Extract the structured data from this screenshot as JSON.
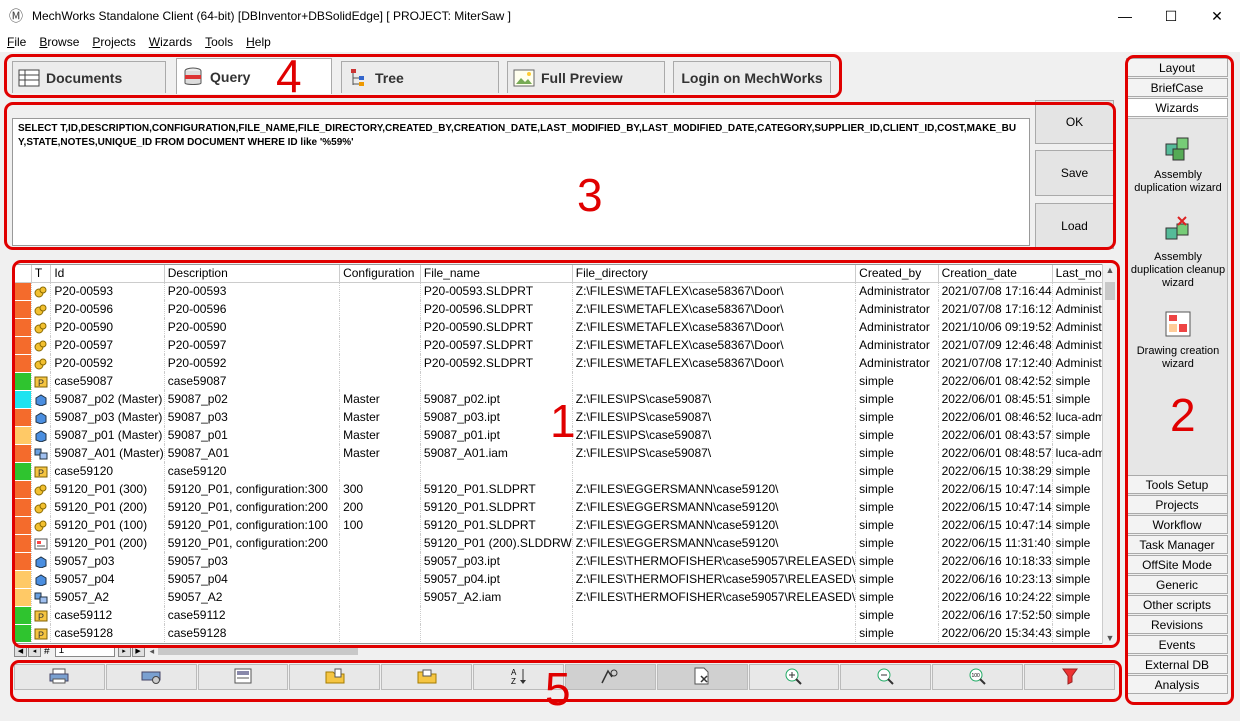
{
  "window": {
    "title": "MechWorks Standalone Client (64-bit) [DBInventor+DBSolidEdge] [ PROJECT: MiterSaw ]",
    "minimize": "—",
    "maximize": "☐",
    "close": "✕"
  },
  "menu": [
    {
      "first": "F",
      "rest": "ile"
    },
    {
      "first": "B",
      "rest": "rowse"
    },
    {
      "first": "P",
      "rest": "rojects"
    },
    {
      "first": "W",
      "rest": "izards"
    },
    {
      "first": "T",
      "rest": "ools"
    },
    {
      "first": "H",
      "rest": "elp"
    }
  ],
  "tabs": [
    {
      "label": "Documents",
      "icon": "table-icon"
    },
    {
      "label": "Query",
      "icon": "database-icon"
    },
    {
      "label": "Tree",
      "icon": "tree-icon"
    },
    {
      "label": "Full Preview",
      "icon": "image-icon"
    },
    {
      "label": "Login on MechWorks",
      "icon": ""
    }
  ],
  "query": {
    "text": "SELECT T,ID,DESCRIPTION,CONFIGURATION,FILE_NAME,FILE_DIRECTORY,CREATED_BY,CREATION_DATE,LAST_MODIFIED_BY,LAST_MODIFIED_DATE,CATEGORY,SUPPLIER_ID,CLIENT_ID,COST,MAKE_BUY,STATE,NOTES,UNIQUE_ID FROM DOCUMENT WHERE ID like '%59%'",
    "ok": "OK",
    "save": "Save",
    "load": "Load"
  },
  "grid": {
    "columns": [
      "T",
      "Id",
      "Description",
      "Configuration",
      "File_name",
      "File_directory",
      "Created_by",
      "Creation_date",
      "Last_moc"
    ],
    "rows": [
      {
        "color": "#f46b2c",
        "type": "asm",
        "id": "P20-00593",
        "desc": "P20-00593",
        "conf": "",
        "file": "P20-00593.SLDPRT",
        "dir": "Z:\\FILES\\METAFLEX\\case58367\\Door\\",
        "by": "Administrator",
        "date": "2021/07/08 17:16:44",
        "mod": "Administ"
      },
      {
        "color": "#f46b2c",
        "type": "asm",
        "id": "P20-00596",
        "desc": "P20-00596",
        "conf": "",
        "file": "P20-00596.SLDPRT",
        "dir": "Z:\\FILES\\METAFLEX\\case58367\\Door\\",
        "by": "Administrator",
        "date": "2021/07/08 17:16:12",
        "mod": "Administ"
      },
      {
        "color": "#f46b2c",
        "type": "asm",
        "id": "P20-00590",
        "desc": "P20-00590",
        "conf": "",
        "file": "P20-00590.SLDPRT",
        "dir": "Z:\\FILES\\METAFLEX\\case58367\\Door\\",
        "by": "Administrator",
        "date": "2021/10/06 09:19:52",
        "mod": "Administ"
      },
      {
        "color": "#f46b2c",
        "type": "asm",
        "id": "P20-00597",
        "desc": "P20-00597",
        "conf": "",
        "file": "P20-00597.SLDPRT",
        "dir": "Z:\\FILES\\METAFLEX\\case58367\\Door\\",
        "by": "Administrator",
        "date": "2021/07/09 12:46:48",
        "mod": "Administ"
      },
      {
        "color": "#f46b2c",
        "type": "asm",
        "id": "P20-00592",
        "desc": "P20-00592",
        "conf": "",
        "file": "P20-00592.SLDPRT",
        "dir": "Z:\\FILES\\METAFLEX\\case58367\\Door\\",
        "by": "Administrator",
        "date": "2021/07/08 17:12:40",
        "mod": "Administ"
      },
      {
        "color": "#2fc42f",
        "type": "proj",
        "id": "case59087",
        "desc": "case59087",
        "conf": "",
        "file": "",
        "dir": "",
        "by": "simple",
        "date": "2022/06/01 08:42:52",
        "mod": "simple"
      },
      {
        "color": "#1ee3f0",
        "type": "part",
        "id": "59087_p02 (Master)",
        "desc": "59087_p02",
        "conf": "Master",
        "file": "59087_p02.ipt",
        "dir": "Z:\\FILES\\IPS\\case59087\\",
        "by": "simple",
        "date": "2022/06/01 08:45:51",
        "mod": "simple"
      },
      {
        "color": "#f46b2c",
        "type": "part",
        "id": "59087_p03 (Master)",
        "desc": "59087_p03",
        "conf": "Master",
        "file": "59087_p03.ipt",
        "dir": "Z:\\FILES\\IPS\\case59087\\",
        "by": "simple",
        "date": "2022/06/01 08:46:52",
        "mod": "luca-adm"
      },
      {
        "color": "#ffc966",
        "type": "part",
        "id": "59087_p01 (Master)",
        "desc": "59087_p01",
        "conf": "Master",
        "file": "59087_p01.ipt",
        "dir": "Z:\\FILES\\IPS\\case59087\\",
        "by": "simple",
        "date": "2022/06/01 08:43:57",
        "mod": "simple"
      },
      {
        "color": "#f46b2c",
        "type": "iam",
        "id": "59087_A01 (Master)",
        "desc": "59087_A01",
        "conf": "Master",
        "file": "59087_A01.iam",
        "dir": "Z:\\FILES\\IPS\\case59087\\",
        "by": "simple",
        "date": "2022/06/01 08:48:57",
        "mod": "luca-adm"
      },
      {
        "color": "#2fc42f",
        "type": "proj",
        "id": "case59120",
        "desc": "case59120",
        "conf": "",
        "file": "",
        "dir": "",
        "by": "simple",
        "date": "2022/06/15 10:38:29",
        "mod": "simple"
      },
      {
        "color": "#f46b2c",
        "type": "asm",
        "id": "59120_P01 (300)",
        "desc": "59120_P01, configuration:300",
        "conf": "300",
        "file": "59120_P01.SLDPRT",
        "dir": "Z:\\FILES\\EGGERSMANN\\case59120\\",
        "by": "simple",
        "date": "2022/06/15 10:47:14",
        "mod": "simple"
      },
      {
        "color": "#f46b2c",
        "type": "asm",
        "id": "59120_P01 (200)",
        "desc": "59120_P01, configuration:200",
        "conf": "200",
        "file": "59120_P01.SLDPRT",
        "dir": "Z:\\FILES\\EGGERSMANN\\case59120\\",
        "by": "simple",
        "date": "2022/06/15 10:47:14",
        "mod": "simple"
      },
      {
        "color": "#f46b2c",
        "type": "asm",
        "id": "59120_P01 (100)",
        "desc": "59120_P01, configuration:100",
        "conf": "100",
        "file": "59120_P01.SLDPRT",
        "dir": "Z:\\FILES\\EGGERSMANN\\case59120\\",
        "by": "simple",
        "date": "2022/06/15 10:47:14",
        "mod": "simple"
      },
      {
        "color": "#f46b2c",
        "type": "drw",
        "id": "59120_P01 (200)",
        "desc": "59120_P01, configuration:200",
        "conf": "",
        "file": "59120_P01 (200).SLDDRW",
        "dir": "Z:\\FILES\\EGGERSMANN\\case59120\\",
        "by": "simple",
        "date": "2022/06/15 11:31:40",
        "mod": "simple"
      },
      {
        "color": "#f46b2c",
        "type": "part",
        "id": "59057_p03",
        "desc": "59057_p03",
        "conf": "",
        "file": "59057_p03.ipt",
        "dir": "Z:\\FILES\\THERMOFISHER\\case59057\\RELEASED\\",
        "by": "simple",
        "date": "2022/06/16 10:18:33",
        "mod": "simple"
      },
      {
        "color": "#ffc966",
        "type": "part",
        "id": "59057_p04",
        "desc": "59057_p04",
        "conf": "",
        "file": "59057_p04.ipt",
        "dir": "Z:\\FILES\\THERMOFISHER\\case59057\\RELEASED\\",
        "by": "simple",
        "date": "2022/06/16 10:23:13",
        "mod": "simple"
      },
      {
        "color": "#ffc966",
        "type": "iam",
        "id": "59057_A2",
        "desc": "59057_A2",
        "conf": "",
        "file": "59057_A2.iam",
        "dir": "Z:\\FILES\\THERMOFISHER\\case59057\\RELEASED\\",
        "by": "simple",
        "date": "2022/06/16 10:24:22",
        "mod": "simple"
      },
      {
        "color": "#2fc42f",
        "type": "proj",
        "id": "case59112",
        "desc": "case59112",
        "conf": "",
        "file": "",
        "dir": "",
        "by": "simple",
        "date": "2022/06/16 17:52:50",
        "mod": "simple"
      },
      {
        "color": "#2fc42f",
        "type": "proj",
        "id": "case59128",
        "desc": "case59128",
        "conf": "",
        "file": "",
        "dir": "",
        "by": "simple",
        "date": "2022/06/20 15:34:43",
        "mod": "simple"
      }
    ]
  },
  "pager": {
    "hash": "#",
    "page": "1"
  },
  "toolbar": [
    "print-icon",
    "print-setup-icon",
    "print-preview-icon",
    "new-folder-icon",
    "open-folder-icon",
    "sort-az-icon",
    "find-icon",
    "delete-doc-icon",
    "zoom-in-icon",
    "zoom-out-icon",
    "zoom-100-icon",
    "filter-icon"
  ],
  "right_panel": {
    "top_buttons": [
      "Layout",
      "BriefCase",
      "Wizards"
    ],
    "wizards": [
      {
        "label": "Assembly duplication wizard",
        "icon": "assembly-duplication-icon"
      },
      {
        "label": "Assembly duplication cleanup wizard",
        "icon": "assembly-cleanup-icon"
      },
      {
        "label": "Drawing creation wizard",
        "icon": "drawing-creation-icon"
      }
    ],
    "bottom_buttons": [
      "Tools Setup",
      "Projects",
      "Workflow",
      "Task Manager",
      "OffSite Mode",
      "Generic",
      "Other scripts",
      "Revisions",
      "Events",
      "External DB",
      "Analysis"
    ]
  },
  "annotations": {
    "n1": "1",
    "n2": "2",
    "n3": "3",
    "n4": "4",
    "n5": "5"
  },
  "colors": {
    "annotation": "#e00000",
    "orange": "#f46b2c",
    "green": "#2fc42f",
    "cyan": "#1ee3f0",
    "light_orange": "#ffc966"
  }
}
